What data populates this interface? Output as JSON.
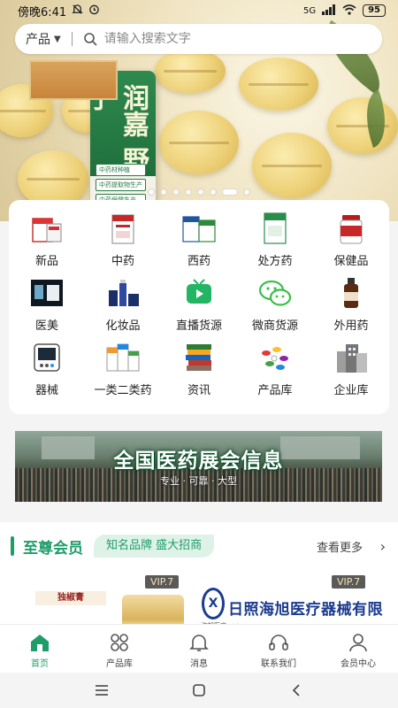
{
  "status_bar": {
    "time": "傍晚6:41",
    "network": "5G",
    "battery": "95"
  },
  "search": {
    "category": "产品",
    "placeholder": "请输入搜索文字"
  },
  "banner": {
    "brand_text": "润嘉 野力子",
    "tags": [
      "中药材种植",
      "中药提取物生产",
      "中药保健生产"
    ],
    "dot_count": 8,
    "active_dot": 6
  },
  "categories": [
    {
      "label": "新品",
      "icon": "new-product-icon"
    },
    {
      "label": "中药",
      "icon": "chinese-medicine-icon"
    },
    {
      "label": "西药",
      "icon": "western-medicine-icon"
    },
    {
      "label": "处方药",
      "icon": "prescription-drug-icon"
    },
    {
      "label": "保健品",
      "icon": "health-product-icon"
    },
    {
      "label": "医美",
      "icon": "medical-beauty-icon"
    },
    {
      "label": "化妆品",
      "icon": "cosmetics-icon"
    },
    {
      "label": "直播货源",
      "icon": "live-stream-icon"
    },
    {
      "label": "微商货源",
      "icon": "wechat-icon"
    },
    {
      "label": "外用药",
      "icon": "external-medicine-icon"
    },
    {
      "label": "器械",
      "icon": "device-icon"
    },
    {
      "label": "一类二类药",
      "icon": "class-drug-icon"
    },
    {
      "label": "资讯",
      "icon": "news-icon"
    },
    {
      "label": "产品库",
      "icon": "product-library-icon"
    },
    {
      "label": "企业库",
      "icon": "enterprise-library-icon"
    }
  ],
  "expo": {
    "title": "全国医药展会信息",
    "subtitle": "专业 · 可靠 · 大型"
  },
  "vip": {
    "title": "至尊会员",
    "tag": "知名品牌 盛大招商",
    "more": "查看更多",
    "arrow": "›",
    "cards": [
      {
        "badge": "VIP.7",
        "product_label": "独椒膏"
      },
      {
        "badge": "VIP.7",
        "logo_letter": "X",
        "company": "日照海旭医疗器械有限公司",
        "company_sub": "海旭医疗"
      }
    ]
  },
  "bottom_nav": [
    {
      "label": "首页",
      "icon": "home-icon",
      "active": true
    },
    {
      "label": "产品库",
      "icon": "grid-icon",
      "active": false
    },
    {
      "label": "消息",
      "icon": "bell-icon",
      "active": false
    },
    {
      "label": "联系我们",
      "icon": "headset-icon",
      "active": false
    },
    {
      "label": "会员中心",
      "icon": "user-icon",
      "active": false
    }
  ],
  "colors": {
    "accent": "#1e9d6a",
    "company_blue": "#1b3b8f",
    "badge_bg": "#5a5a5a",
    "badge_text": "#f2e1b0"
  }
}
